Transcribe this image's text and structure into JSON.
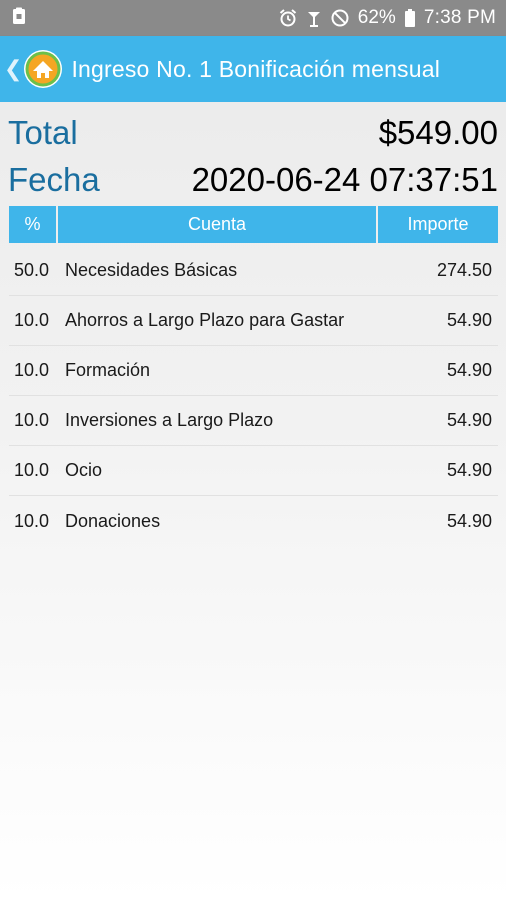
{
  "status_bar": {
    "battery_percent": "62%",
    "time": "7:38 PM",
    "icons": [
      "notification-icon",
      "alarm-icon",
      "wifi-icon",
      "do-not-disturb-icon",
      "battery-icon"
    ]
  },
  "app_bar": {
    "back_glyph": "❮",
    "title": "Ingreso No. 1 Bonificación mensual",
    "logo_icon": "app-logo-icon"
  },
  "summary": {
    "total_label": "Total",
    "total_value": "$549.00",
    "fecha_label": "Fecha",
    "fecha_value": "2020-06-24 07:37:51"
  },
  "table": {
    "headers": {
      "pct": "%",
      "cuenta": "Cuenta",
      "importe": "Importe"
    },
    "rows": [
      {
        "pct": "50.0",
        "cuenta": "Necesidades Básicas",
        "importe": "274.50"
      },
      {
        "pct": "10.0",
        "cuenta": "Ahorros a Largo Plazo para Gastar",
        "importe": "54.90"
      },
      {
        "pct": "10.0",
        "cuenta": "Formación",
        "importe": "54.90"
      },
      {
        "pct": "10.0",
        "cuenta": "Inversiones a Largo Plazo",
        "importe": "54.90"
      },
      {
        "pct": "10.0",
        "cuenta": "Ocio",
        "importe": "54.90"
      },
      {
        "pct": "10.0",
        "cuenta": "Donaciones",
        "importe": "54.90"
      }
    ]
  },
  "colors": {
    "accent": "#3fb5ea",
    "status_bar": "#8a8a8a",
    "label_blue": "#1a6e9f"
  }
}
